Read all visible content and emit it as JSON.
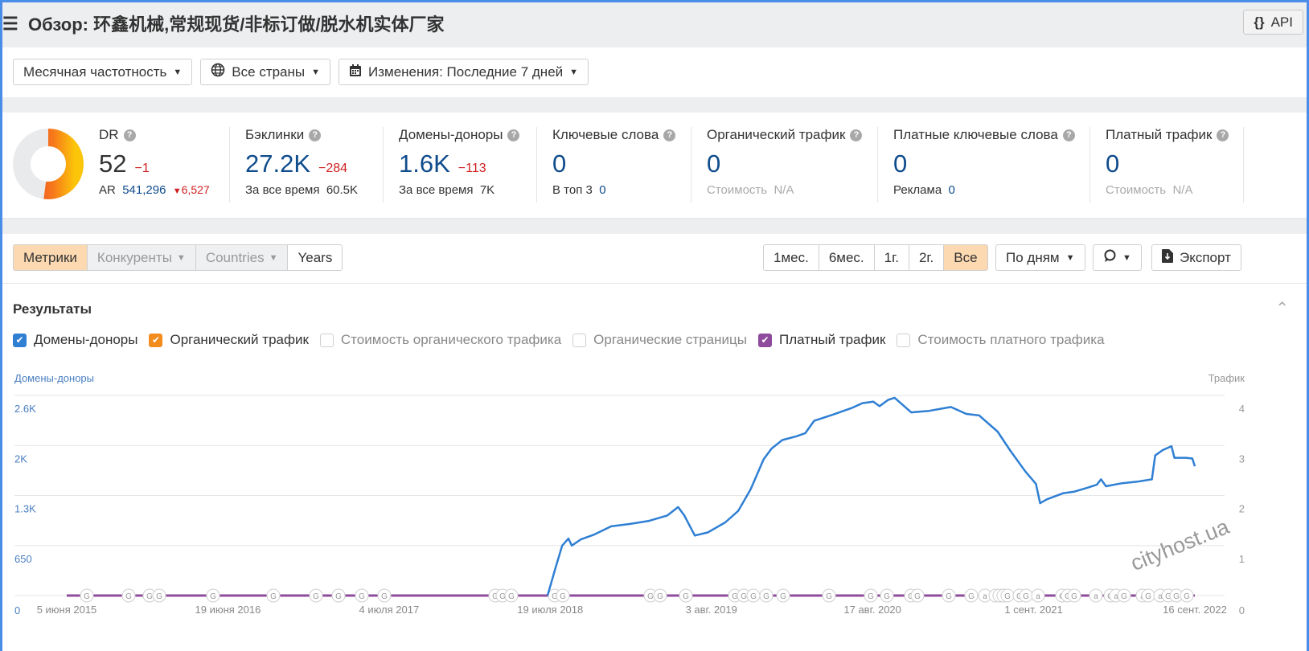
{
  "header": {
    "title": "Обзор: 环鑫机械,常规现货/非标订做/脱水机实体厂家",
    "api_label": "API",
    "menu_icon": "hamburger-icon",
    "api_icon": "curly-braces-icon"
  },
  "filters": {
    "frequency": "Месячная частотность",
    "countries": "Все страны",
    "changes": "Изменения: Последние 7 дней"
  },
  "metrics": {
    "dr": {
      "label": "DR",
      "value": "52",
      "delta": "−1",
      "ar_label": "AR",
      "ar_value": "541,296",
      "ar_delta": "6,527",
      "rating_fraction": 0.52
    },
    "backlinks": {
      "label": "Бэклинки",
      "value": "27.2K",
      "delta": "−284",
      "sub_label": "За все время",
      "sub_value": "60.5K"
    },
    "ref_domains": {
      "label": "Домены-доноры",
      "value": "1.6K",
      "delta": "−113",
      "sub_label": "За все время",
      "sub_value": "7K"
    },
    "keywords": {
      "label": "Ключевые слова",
      "value": "0",
      "sub_label": "В топ 3",
      "sub_value": "0"
    },
    "organic_traffic": {
      "label": "Органический трафик",
      "value": "0",
      "sub_label": "Стоимость",
      "sub_value": "N/A"
    },
    "paid_keywords": {
      "label": "Платные ключевые слова",
      "value": "0",
      "sub_label": "Реклама",
      "sub_value": "0"
    },
    "paid_traffic": {
      "label": "Платный трафик",
      "value": "0",
      "sub_label": "Стоимость",
      "sub_value": "N/A"
    }
  },
  "toolbar": {
    "tabs": [
      "Метрики",
      "Конкуренты",
      "Countries",
      "Years"
    ],
    "ranges": [
      "1мес.",
      "6мес.",
      "1г.",
      "2г.",
      "Все"
    ],
    "active_range": "Все",
    "granularity": "По дням",
    "export": "Экспорт"
  },
  "results": {
    "title": "Результаты",
    "legend": [
      {
        "label": "Домены-доноры",
        "checked": true,
        "color": "#2f7fd3"
      },
      {
        "label": "Органический трафик",
        "checked": true,
        "color": "#f28c1c"
      },
      {
        "label": "Стоимость органического трафика",
        "checked": false
      },
      {
        "label": "Органические страницы",
        "checked": false
      },
      {
        "label": "Платный трафик",
        "checked": true,
        "color": "#8e4a9c"
      },
      {
        "label": "Стоимость платного трафика",
        "checked": false
      }
    ]
  },
  "watermark": "cityhost.ua",
  "chart_data": {
    "type": "line",
    "left_axis_label": "Домены-доноры",
    "right_axis_label": "Трафик",
    "y_left_ticks": [
      "0",
      "650",
      "1.3K",
      "2K",
      "2.6K"
    ],
    "y_left_tick_values": [
      0,
      650,
      1300,
      1950,
      2600
    ],
    "y_right_ticks": [
      "0",
      "1",
      "2",
      "3",
      "4"
    ],
    "ylim_left": [
      0,
      2600
    ],
    "ylim_right": [
      0,
      4
    ],
    "x_ticks": [
      "5 июня 2015",
      "19 июня 2016",
      "4 июля 2017",
      "19 июля 2018",
      "3 авг. 2019",
      "17 авг. 2020",
      "1 сент. 2021",
      "16 сент. 2022"
    ],
    "x_range": [
      "2015-06-05",
      "2022-10-31"
    ],
    "series": [
      {
        "name": "Домены-доноры",
        "color": "#2f7fd3",
        "axis": "left",
        "points": [
          [
            "2018-08-01",
            0
          ],
          [
            "2018-08-20",
            360
          ],
          [
            "2018-09-05",
            650
          ],
          [
            "2018-09-10",
            680
          ],
          [
            "2018-09-20",
            740
          ],
          [
            "2018-09-28",
            650
          ],
          [
            "2018-10-20",
            730
          ],
          [
            "2018-11-20",
            790
          ],
          [
            "2018-12-05",
            830
          ],
          [
            "2019-01-01",
            900
          ],
          [
            "2019-02-15",
            930
          ],
          [
            "2019-04-01",
            970
          ],
          [
            "2019-05-15",
            1040
          ],
          [
            "2019-06-10",
            1150
          ],
          [
            "2019-06-25",
            1040
          ],
          [
            "2019-07-20",
            780
          ],
          [
            "2019-08-20",
            820
          ],
          [
            "2019-10-01",
            950
          ],
          [
            "2019-11-01",
            1100
          ],
          [
            "2019-12-01",
            1380
          ],
          [
            "2020-01-01",
            1770
          ],
          [
            "2020-01-20",
            1910
          ],
          [
            "2020-02-15",
            2020
          ],
          [
            "2020-03-20",
            2070
          ],
          [
            "2020-04-10",
            2110
          ],
          [
            "2020-05-01",
            2270
          ],
          [
            "2020-06-15",
            2350
          ],
          [
            "2020-08-01",
            2440
          ],
          [
            "2020-08-25",
            2500
          ],
          [
            "2020-09-20",
            2520
          ],
          [
            "2020-10-05",
            2460
          ],
          [
            "2020-10-25",
            2540
          ],
          [
            "2020-11-10",
            2570
          ],
          [
            "2020-12-20",
            2380
          ],
          [
            "2021-02-01",
            2400
          ],
          [
            "2021-03-25",
            2450
          ],
          [
            "2021-05-01",
            2360
          ],
          [
            "2021-06-01",
            2340
          ],
          [
            "2021-07-15",
            2130
          ],
          [
            "2021-08-15",
            1880
          ],
          [
            "2021-09-20",
            1610
          ],
          [
            "2021-10-15",
            1450
          ],
          [
            "2021-10-25",
            1200
          ],
          [
            "2021-11-10",
            1250
          ],
          [
            "2021-12-20",
            1330
          ],
          [
            "2022-01-15",
            1350
          ],
          [
            "2022-02-15",
            1400
          ],
          [
            "2022-03-10",
            1440
          ],
          [
            "2022-03-20",
            1510
          ],
          [
            "2022-04-01",
            1420
          ],
          [
            "2022-05-10",
            1460
          ],
          [
            "2022-06-15",
            1480
          ],
          [
            "2022-07-20",
            1510
          ],
          [
            "2022-07-28",
            1820
          ],
          [
            "2022-08-15",
            1890
          ],
          [
            "2022-09-05",
            1940
          ],
          [
            "2022-09-12",
            1790
          ],
          [
            "2022-10-10",
            1790
          ],
          [
            "2022-10-25",
            1780
          ],
          [
            "2022-10-31",
            1680
          ]
        ]
      },
      {
        "name": "Платный трафик",
        "color": "#8e4a9c",
        "axis": "right",
        "points": [
          [
            "2015-06-05",
            0
          ],
          [
            "2022-10-31",
            0
          ]
        ]
      }
    ],
    "annotation_markers": {
      "labels": [
        "G",
        "a"
      ],
      "description": "Google update markers along x-axis"
    },
    "grid": true,
    "legend_position": "top-left"
  }
}
